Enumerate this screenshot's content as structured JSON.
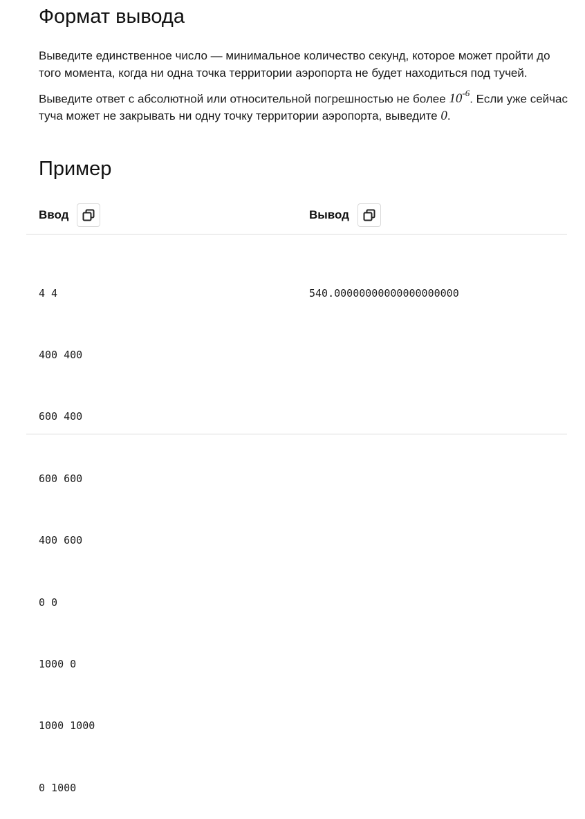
{
  "output_format": {
    "title": "Формат вывода",
    "p1": "Выведите единственное число — минимальное количество секунд, которое может пройти до того момента, когда ни одна точка территории аэропорта не будет находиться под тучей.",
    "p2_before": "Выведите ответ с абсолютной или относительной погрешностью не более ",
    "p2_math_base": "10",
    "p2_math_exp": "-6",
    "p2_middle": ". Если уже сейчас туча может не закрывать ни одну точку территории аэропорта, выведите ",
    "p2_math_zero": "0",
    "p2_after": "."
  },
  "example": {
    "title": "Пример",
    "input_label": "Ввод",
    "output_label": "Вывод",
    "input_lines": [
      "4 4",
      "400 400",
      "600 400",
      "600 600",
      "400 600",
      "0 0",
      "1000 0",
      "1000 1000",
      "0 1000"
    ],
    "output_lines": [
      "540.00000000000000000000"
    ]
  },
  "icons": {
    "copy": "copy-icon"
  }
}
